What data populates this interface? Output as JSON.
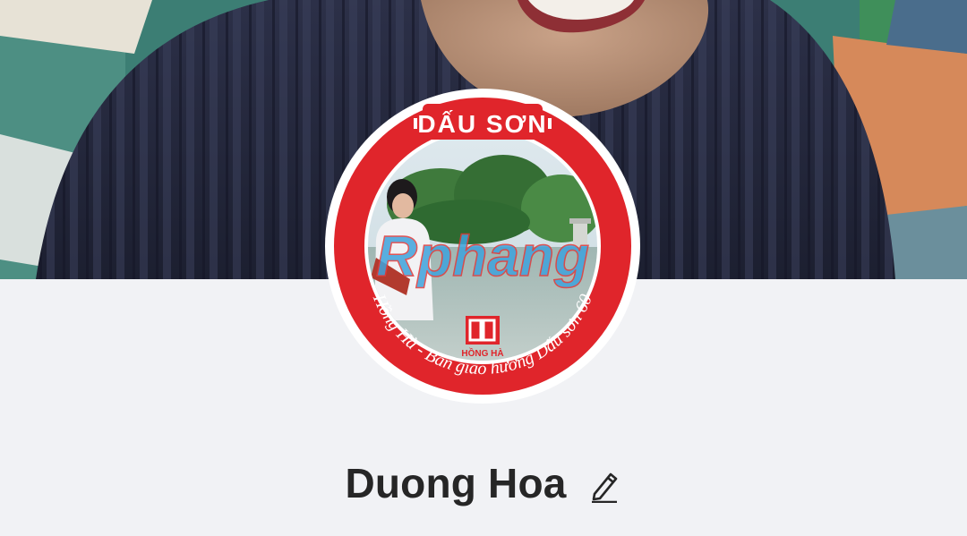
{
  "profile": {
    "name": "Duong Hoa",
    "edit_name_icon": "pencil-icon"
  },
  "cover": {
    "description_icon": "cover-photo"
  },
  "avatar": {
    "frame_top_text": "DẤU SƠN",
    "frame_bottom_text": "Hồng Hà - Bản giao hưởng Dấu sơn 60",
    "logo_text": "HỒNG HÀ",
    "watermark": "Rphang",
    "frame_color": "#e0252b"
  },
  "colors": {
    "background": "#f1f2f5",
    "name_text": "#262626"
  }
}
